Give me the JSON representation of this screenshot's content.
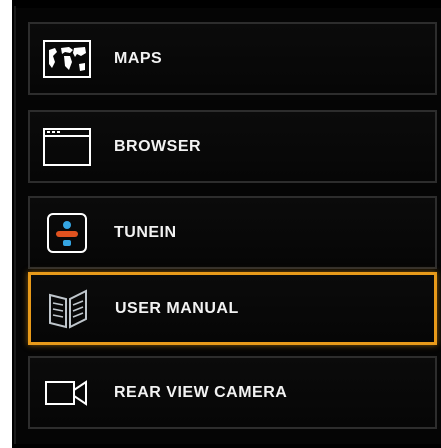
{
  "menu": {
    "items": [
      {
        "label": "MAPS",
        "icon": "map-icon",
        "selected": false
      },
      {
        "label": "BROWSER",
        "icon": "browser-window-icon",
        "selected": false
      },
      {
        "label": "TUNEIN",
        "icon": "tunein-icon",
        "selected": false
      },
      {
        "label": "USER MANUAL",
        "icon": "book-icon",
        "selected": true
      },
      {
        "label": "REAR VIEW CAMERA",
        "icon": "camera-icon",
        "selected": false
      }
    ]
  },
  "colors": {
    "background": "#000000",
    "border": "#2d2d2d",
    "selected_border": "#e89a1a",
    "text": "#f2f2f2",
    "tunein_accent": "#e0521f",
    "tunein_blue": "#35a5e3"
  }
}
